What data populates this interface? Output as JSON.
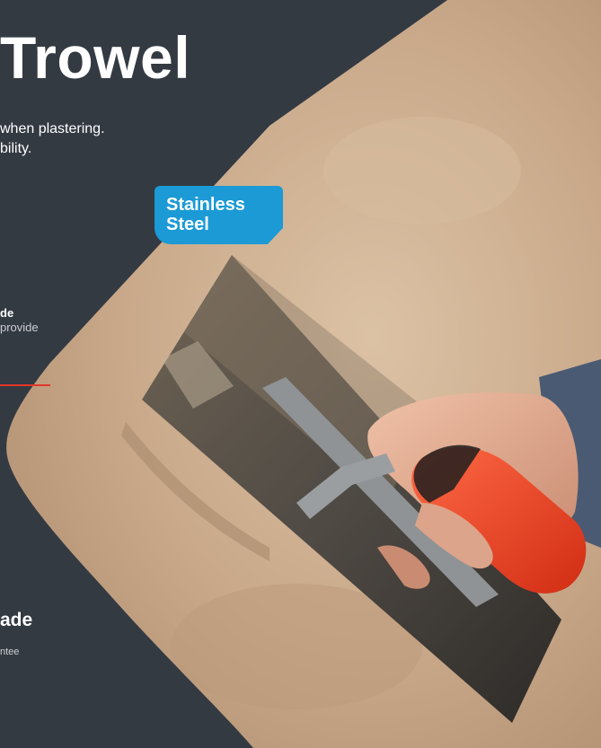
{
  "heading": {
    "title": "Trowel"
  },
  "intro": {
    "lines": [
      "when plastering.",
      "bility."
    ]
  },
  "badge": {
    "line1": "Stainless",
    "line2": "Steel"
  },
  "features": [
    {
      "title": "de",
      "desc": "provide"
    },
    {
      "title": "ade",
      "desc": "ntee"
    }
  ],
  "colors": {
    "panel": "#343a42",
    "badge": "#1b9ad6",
    "divider": "#e2372a",
    "wall": "#c9a98a",
    "handle": "#e8432a"
  }
}
